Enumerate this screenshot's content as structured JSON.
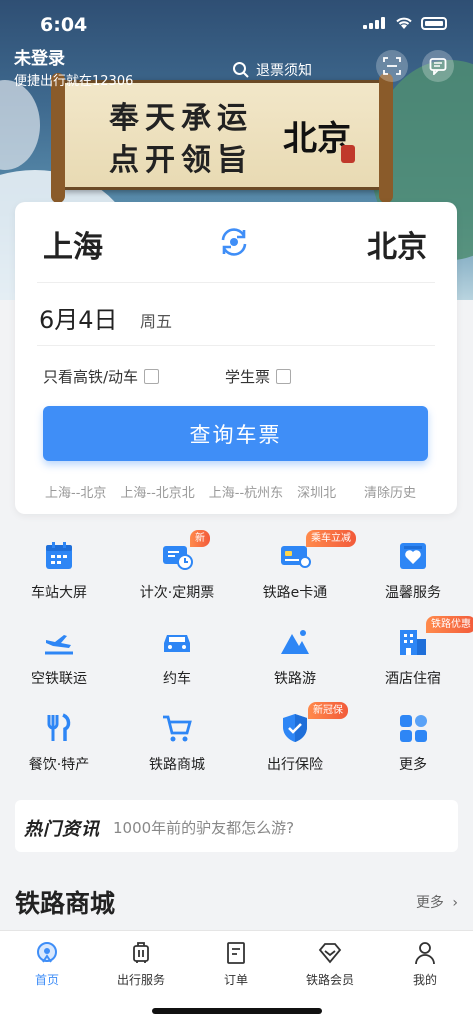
{
  "colors": {
    "accent": "#3f8ef7",
    "badge": "#f25a3a",
    "background": "#f2f3f5"
  },
  "status_bar": {
    "time": "6:04"
  },
  "header": {
    "login_title": "未登录",
    "login_subtitle": "便捷出行就在12306",
    "search_hint": "退票须知",
    "banner_line1": "奉天承运",
    "banner_line2": "点开领旨",
    "banner_city": "北京"
  },
  "search": {
    "from_city": "上海",
    "to_city": "北京",
    "date": "6月4日",
    "weekday": "周五",
    "option_highspeed": "只看高铁/动车",
    "option_student": "学生票",
    "query_button": "查询车票",
    "history": [
      "上海--北京",
      "上海--北京北",
      "上海--杭州东",
      "深圳北"
    ],
    "clear_history": "清除历史"
  },
  "services": [
    {
      "label": "车站大屏",
      "icon": "calendar-screen-icon",
      "badge": ""
    },
    {
      "label": "计次·定期票",
      "icon": "ticket-clock-icon",
      "badge": "新"
    },
    {
      "label": "铁路e卡通",
      "icon": "card-icon",
      "badge": "乘车立减"
    },
    {
      "label": "温馨服务",
      "icon": "heart-service-icon",
      "badge": ""
    },
    {
      "label": "空铁联运",
      "icon": "plane-train-icon",
      "badge": ""
    },
    {
      "label": "约车",
      "icon": "car-icon",
      "badge": ""
    },
    {
      "label": "铁路游",
      "icon": "mountain-icon",
      "badge": ""
    },
    {
      "label": "酒店住宿",
      "icon": "hotel-icon",
      "badge": "铁路优惠"
    },
    {
      "label": "餐饮·特产",
      "icon": "fork-knife-icon",
      "badge": ""
    },
    {
      "label": "铁路商城",
      "icon": "cart-icon",
      "badge": ""
    },
    {
      "label": "出行保险",
      "icon": "shield-icon",
      "badge": "新冠保"
    },
    {
      "label": "更多",
      "icon": "grid-more-icon",
      "badge": ""
    }
  ],
  "news": {
    "logo": "热门资讯",
    "text": "1000年前的驴友都怎么游?"
  },
  "mall": {
    "title": "铁路商城",
    "more": "更多"
  },
  "tabbar": [
    {
      "label": "首页",
      "active": true
    },
    {
      "label": "出行服务",
      "active": false
    },
    {
      "label": "订单",
      "active": false
    },
    {
      "label": "铁路会员",
      "active": false
    },
    {
      "label": "我的",
      "active": false
    }
  ]
}
